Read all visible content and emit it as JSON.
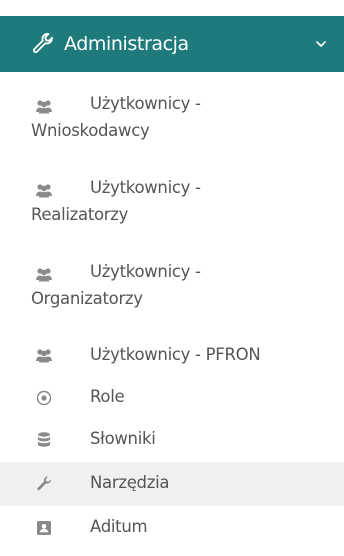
{
  "header": {
    "title": "Administracja",
    "icon": "wrench-icon",
    "chevron": "chevron-down-icon",
    "bg_color": "#1f7a7c"
  },
  "items": [
    {
      "line1": "Użytkownicy -",
      "line2": "Wnioskodawcy",
      "icon": "users-icon"
    },
    {
      "line1": "Użytkownicy -",
      "line2": "Realizatorzy",
      "icon": "users-icon"
    },
    {
      "line1": "Użytkownicy -",
      "line2": "Organizatorzy",
      "icon": "users-icon"
    },
    {
      "line1": "Użytkownicy - PFRON",
      "icon": "users-icon"
    },
    {
      "line1": "Role",
      "icon": "target-circle-icon"
    },
    {
      "line1": "Słowniki",
      "icon": "database-icon"
    },
    {
      "line1": "Narzędzia",
      "icon": "wrench-icon",
      "active": true
    },
    {
      "line1": "Aditum",
      "icon": "id-card-icon"
    }
  ],
  "colors": {
    "item_text": "#555555",
    "icon": "#8a8a8a",
    "active_bg": "#f0f0f0"
  }
}
